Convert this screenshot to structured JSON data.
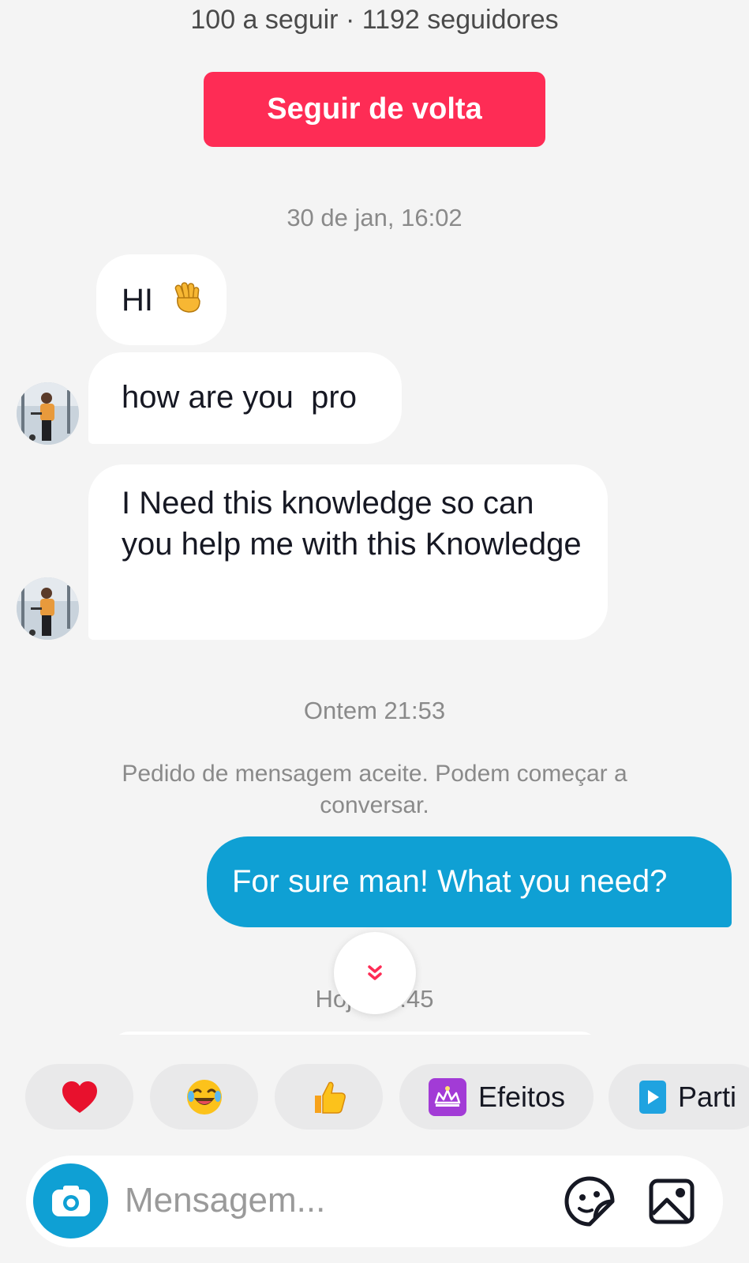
{
  "header": {
    "follow_stats": "100 a seguir · 1192 seguidores",
    "follow_back_label": "Seguir de volta"
  },
  "conversation": {
    "timestamp_1": "30 de jan, 16:02",
    "messages_group_1": [
      {
        "text": "HI",
        "emoji": "waving-hand"
      },
      {
        "text": "how are you  pro"
      },
      {
        "text": "I Need this knowledge so can you help me with this Knowledge"
      }
    ],
    "timestamp_2": "Ontem 21:53",
    "system_note": "Pedido de mensagem aceite. Podem começar a conversar.",
    "outgoing_message": "For sure man! What you need?",
    "timestamp_3": "Hoje 21:45"
  },
  "quick_actions": [
    {
      "icon": "heart-icon"
    },
    {
      "icon": "laughing-face-icon"
    },
    {
      "icon": "thumbs-up-icon"
    },
    {
      "icon": "effects-icon",
      "label": "Efeitos"
    },
    {
      "icon": "share-play-icon",
      "label": "Parti"
    }
  ],
  "composer": {
    "placeholder": "Mensagem...",
    "left_icon": "camera-icon",
    "right_icons": [
      "sticker-icon",
      "gallery-icon"
    ]
  },
  "colors": {
    "follow_button": "#fe2c55",
    "outgoing_bubble": "#0fa0d4",
    "background": "#f4f4f4"
  }
}
